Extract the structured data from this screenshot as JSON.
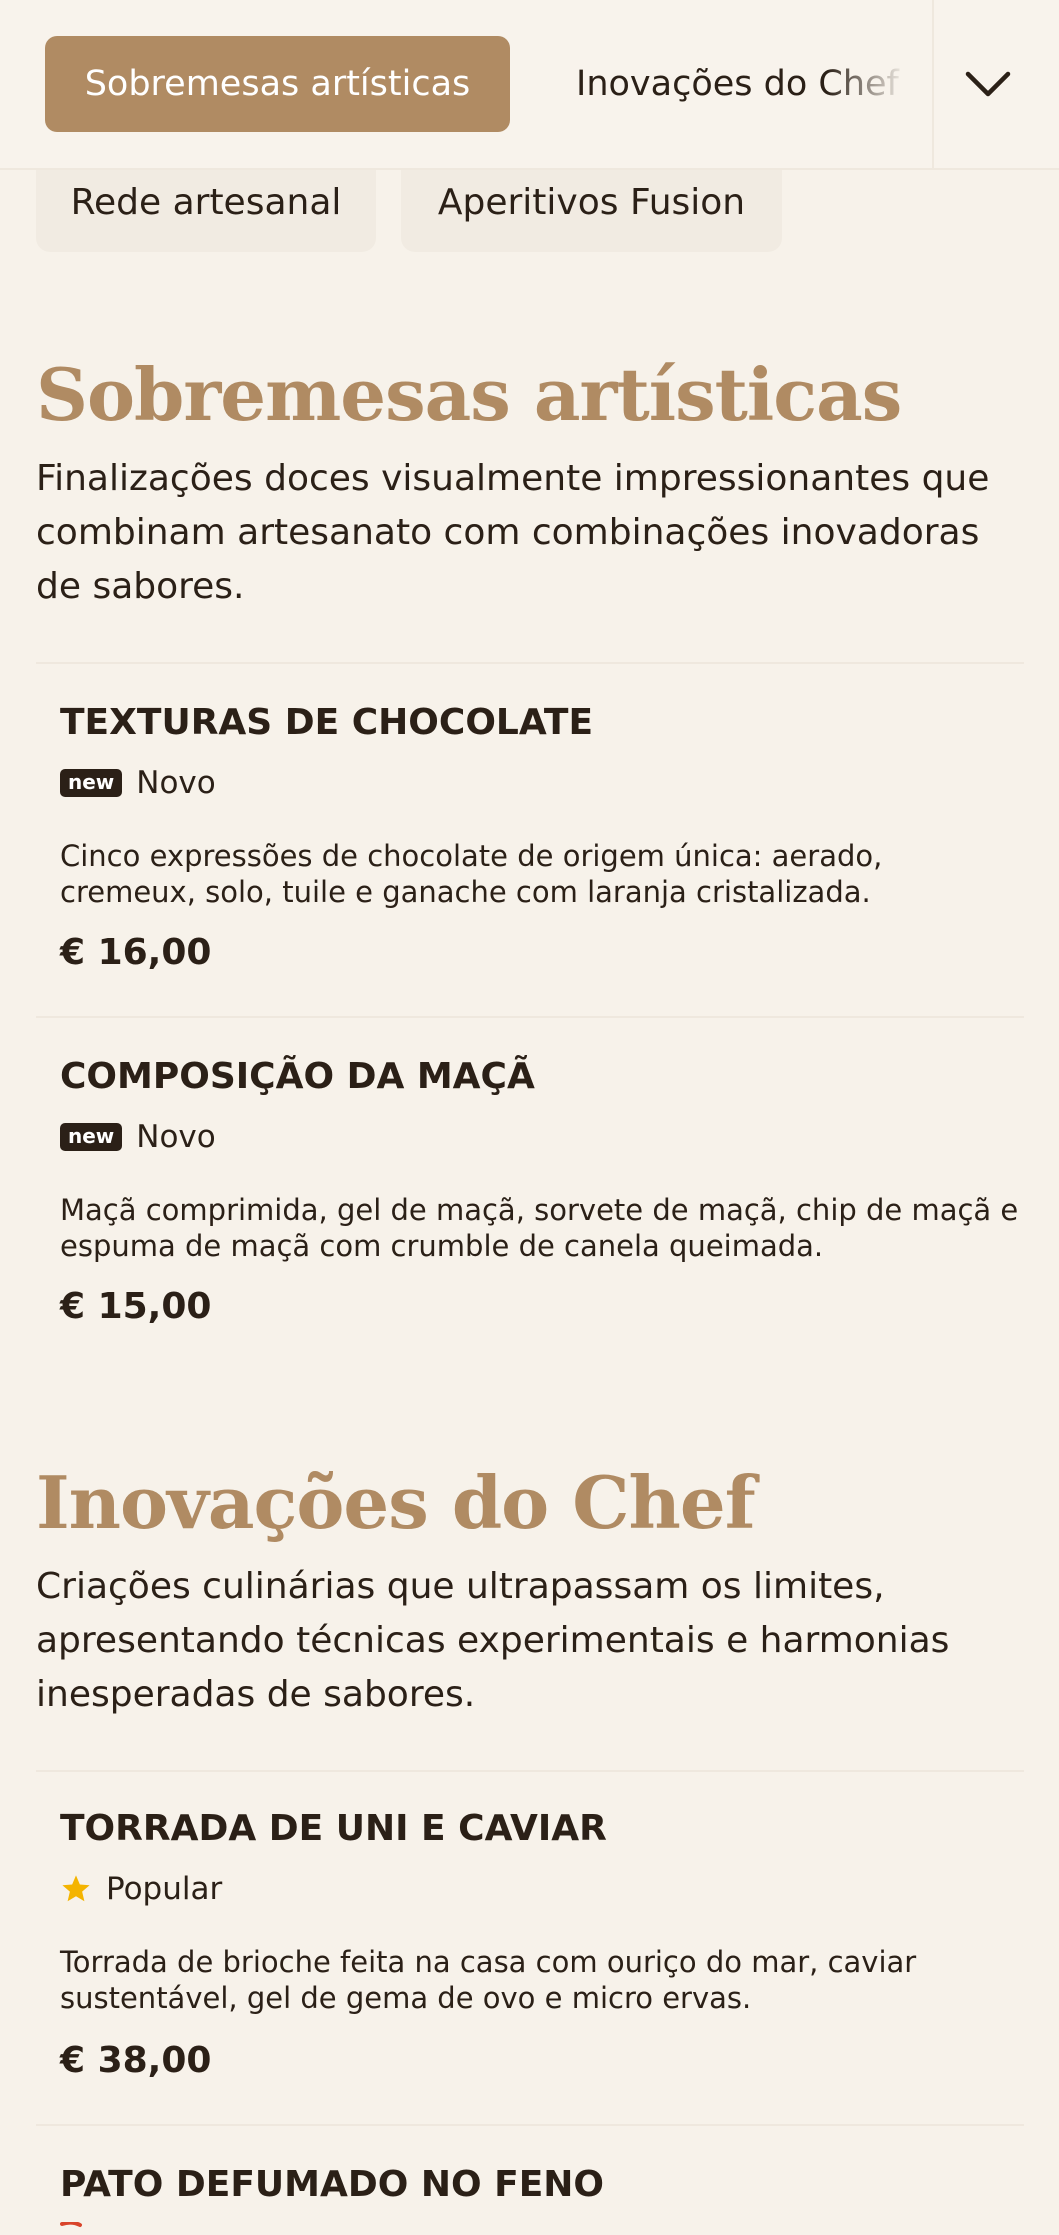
{
  "nav": {
    "active_category": "Sobremesas artísticas",
    "next_category": "Inovações do Chef",
    "chips": [
      "Rede artesanal",
      "Aperitivos Fusion"
    ]
  },
  "sections": [
    {
      "title": "Sobremesas artísticas",
      "description": "Finalizações doces visualmente impressionantes que combinam artesanato com combinações inovadoras de sabores.",
      "items": [
        {
          "name": "TEXTURAS DE CHOCOLATE",
          "badge_tag": "new",
          "badge_label": "Novo",
          "description": "Cinco expressões de chocolate de origem única: aerado, cremeux, solo, tuile e ganache com laranja cristalizada.",
          "price": "€ 16,00"
        },
        {
          "name": "COMPOSIÇÃO DA MAÇÃ",
          "badge_tag": "new",
          "badge_label": "Novo",
          "description": "Maçã comprimida, gel de maçã, sorvete de maçã, chip de maçã e espuma de maçã com crumble de canela queimada.",
          "price": "€ 15,00"
        }
      ]
    },
    {
      "title": "Inovações do Chef",
      "description": "Criações culinárias que ultrapassam os limites, apresentando técnicas experimentais e harmonias inesperadas de sabores.",
      "items": [
        {
          "name": "TORRADA DE UNI E CAVIAR",
          "badge_icon": "star-icon",
          "badge_label": "Popular",
          "description": "Torrada de brioche feita na casa com ouriço do mar, caviar sustentável, gel de gema de ovo e micro ervas.",
          "price": "€ 38,00"
        },
        {
          "name": "PATO DEFUMADO NO FENO"
        }
      ]
    }
  ],
  "colors": {
    "accent": "#b08b63",
    "background": "#f7f2ea",
    "text": "#2b2017",
    "star": "#f4b400",
    "spicy": "#d9442b"
  }
}
